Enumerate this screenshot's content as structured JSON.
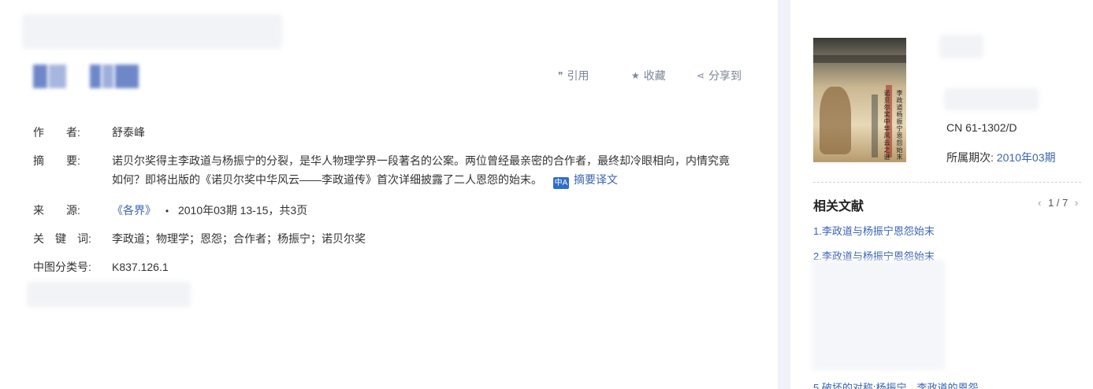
{
  "article": {
    "actions": {
      "cite": "引用",
      "favorite": "收藏",
      "share": "分享到"
    },
    "author_label": "作　　者:",
    "author": "舒泰峰",
    "abstract_label": "摘　　要:",
    "abstract_line1": "诺贝尔奖得主李政道与杨振宁的分裂，是华人物理学界一段著名的公案。两位曾经最亲密的合作者，最终却冷眼相向，内情究竟",
    "abstract_line2": "如何？即将出版的《诺贝尔奖中华风云——李政道传》首次详细披露了二人恩怨的始末。",
    "translate_icon": "中A",
    "translate_label": "摘要译文",
    "source_label": "来　　源:",
    "source_journal": "《各界》",
    "source_sep": "•",
    "source_detail": "2010年03期 13-15，共3页",
    "keywords_label": "关　键　词:",
    "keywords": [
      "李政道",
      "物理学",
      "恩怨",
      "合作者",
      "杨振宁",
      "诺贝尔奖"
    ],
    "keyword_sep": "；",
    "clc_label": "中图分类号:",
    "clc": "K837.126.1"
  },
  "sidebar": {
    "cover_texts": [
      "李政道杨振宁恩怨始末",
      "诺贝尔奖中华风云之谜"
    ],
    "cn_number": "CN 61-1302/D",
    "issue_label": "所属期次:",
    "issue_value": "2010年03期",
    "related_title": "相关文献",
    "pager": {
      "prev": "‹",
      "current": "1 / 7",
      "next": "›"
    },
    "related_items": [
      "1.李政道与杨振宁恩怨始末",
      "2.李政道与杨振宁恩怨始末",
      "5.破坏的对称:杨振宁、李政道的恩怨"
    ]
  },
  "icons": [
    "quote-icon",
    "star-icon",
    "share-icon",
    "translate-icon",
    "chevron-left-icon",
    "chevron-right-icon"
  ]
}
